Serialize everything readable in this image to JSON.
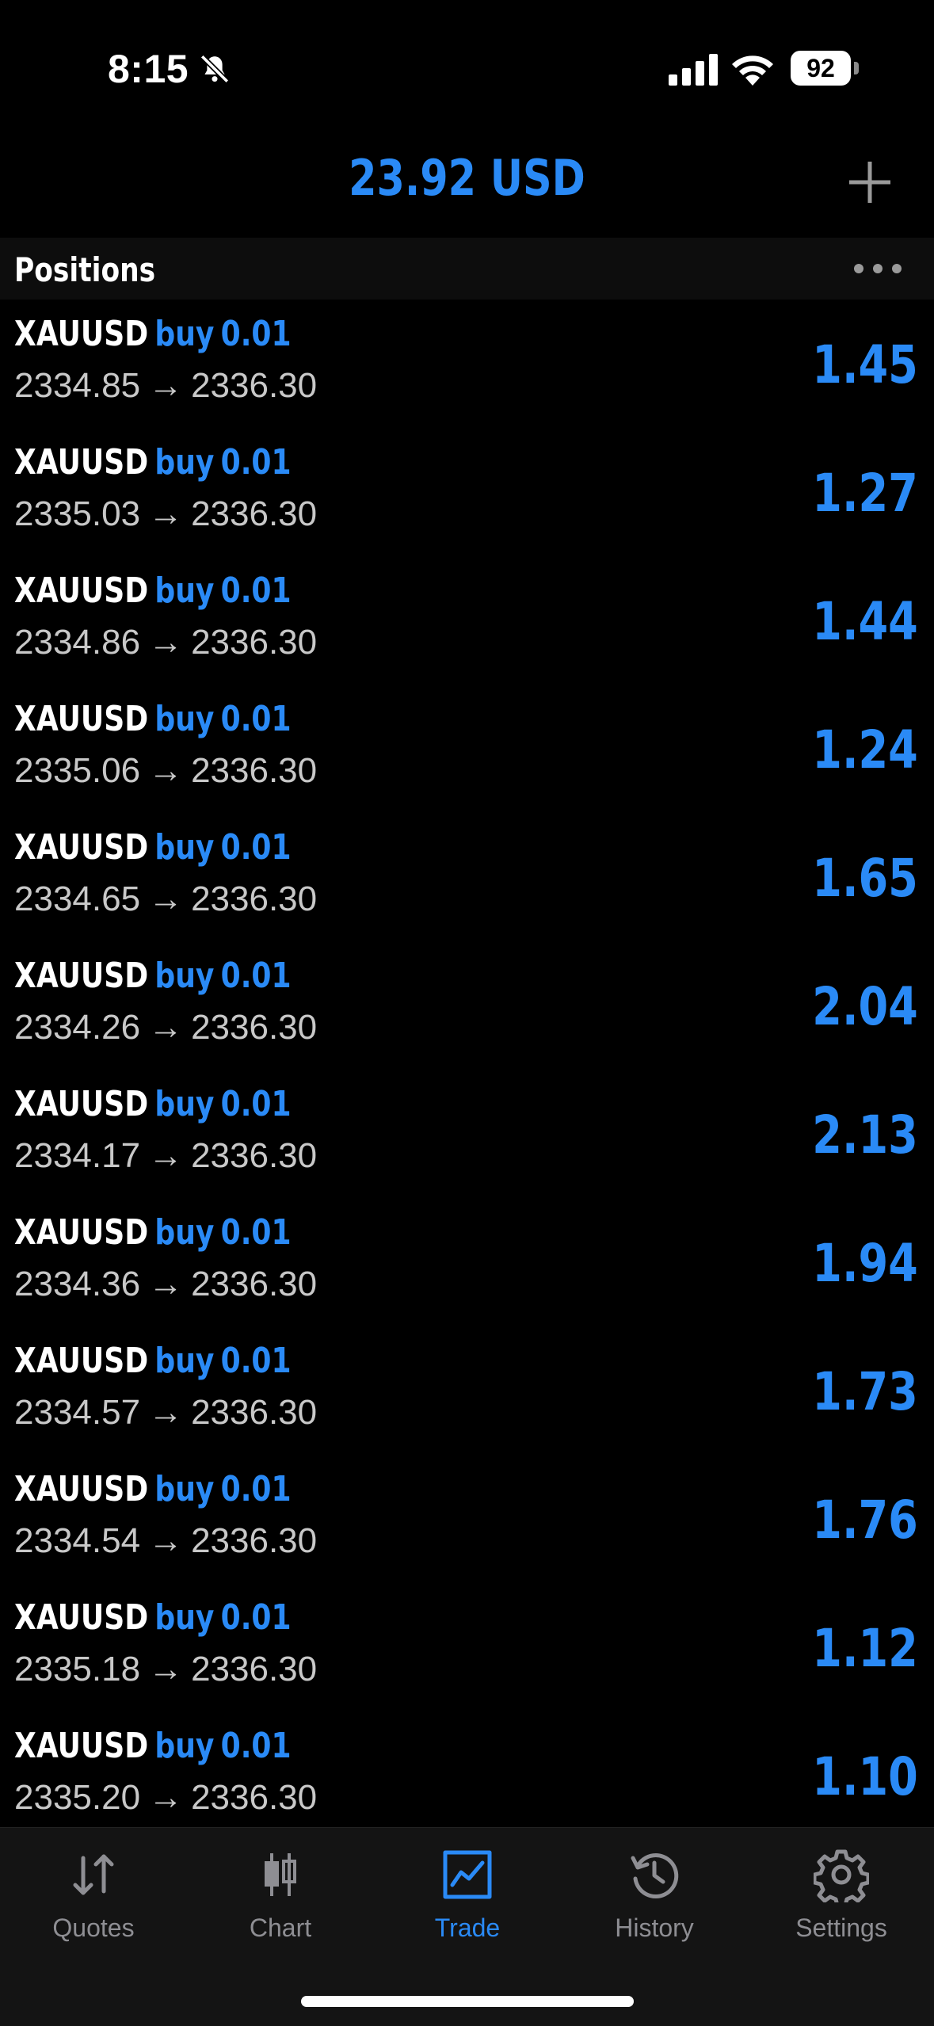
{
  "status_bar": {
    "time": "8:15",
    "battery": "92"
  },
  "header": {
    "balance": "23.92 USD"
  },
  "section": {
    "title": "Positions"
  },
  "positions": [
    {
      "symbol": "XAUUSD",
      "side": "buy",
      "volume": "0.01",
      "open_price": "2334.85",
      "current_price": "2336.30",
      "profit": "1.45"
    },
    {
      "symbol": "XAUUSD",
      "side": "buy",
      "volume": "0.01",
      "open_price": "2335.03",
      "current_price": "2336.30",
      "profit": "1.27"
    },
    {
      "symbol": "XAUUSD",
      "side": "buy",
      "volume": "0.01",
      "open_price": "2334.86",
      "current_price": "2336.30",
      "profit": "1.44"
    },
    {
      "symbol": "XAUUSD",
      "side": "buy",
      "volume": "0.01",
      "open_price": "2335.06",
      "current_price": "2336.30",
      "profit": "1.24"
    },
    {
      "symbol": "XAUUSD",
      "side": "buy",
      "volume": "0.01",
      "open_price": "2334.65",
      "current_price": "2336.30",
      "profit": "1.65"
    },
    {
      "symbol": "XAUUSD",
      "side": "buy",
      "volume": "0.01",
      "open_price": "2334.26",
      "current_price": "2336.30",
      "profit": "2.04"
    },
    {
      "symbol": "XAUUSD",
      "side": "buy",
      "volume": "0.01",
      "open_price": "2334.17",
      "current_price": "2336.30",
      "profit": "2.13"
    },
    {
      "symbol": "XAUUSD",
      "side": "buy",
      "volume": "0.01",
      "open_price": "2334.36",
      "current_price": "2336.30",
      "profit": "1.94"
    },
    {
      "symbol": "XAUUSD",
      "side": "buy",
      "volume": "0.01",
      "open_price": "2334.57",
      "current_price": "2336.30",
      "profit": "1.73"
    },
    {
      "symbol": "XAUUSD",
      "side": "buy",
      "volume": "0.01",
      "open_price": "2334.54",
      "current_price": "2336.30",
      "profit": "1.76"
    },
    {
      "symbol": "XAUUSD",
      "side": "buy",
      "volume": "0.01",
      "open_price": "2335.18",
      "current_price": "2336.30",
      "profit": "1.12"
    },
    {
      "symbol": "XAUUSD",
      "side": "buy",
      "volume": "0.01",
      "open_price": "2335.20",
      "current_price": "2336.30",
      "profit": "1.10"
    }
  ],
  "tabs": [
    {
      "label": "Quotes",
      "icon": "quotes-arrows-icon"
    },
    {
      "label": "Chart",
      "icon": "candlestick-icon"
    },
    {
      "label": "Trade",
      "icon": "trade-chart-icon",
      "active": true
    },
    {
      "label": "History",
      "icon": "history-clock-icon"
    },
    {
      "label": "Settings",
      "icon": "gear-icon"
    }
  ],
  "colors": {
    "accent": "#2a8af6",
    "background": "#000000",
    "tab_bar": "#141414",
    "inactive": "#8e8e93"
  }
}
